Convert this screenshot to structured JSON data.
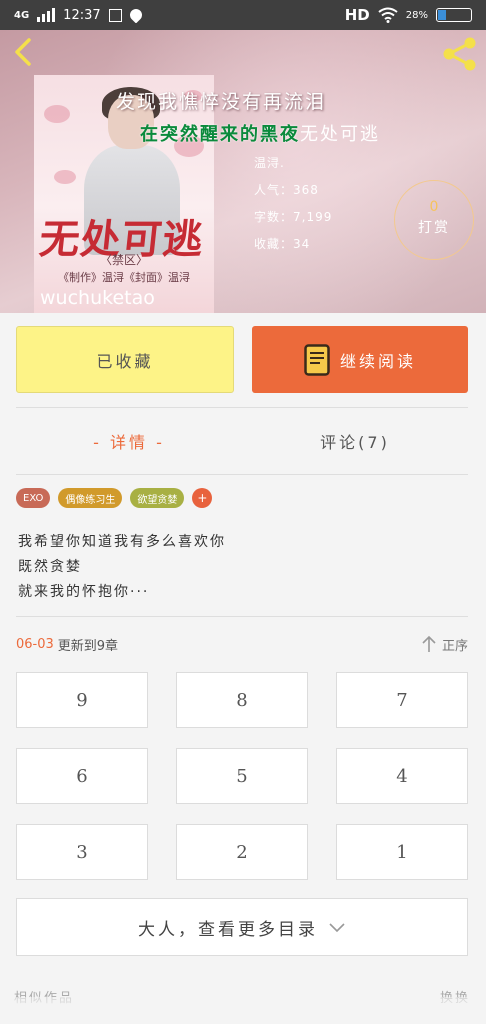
{
  "status_bar": {
    "network": "4G",
    "time": "12:37",
    "hd": "HD",
    "battery": "28%",
    "battery_level_percent": 28
  },
  "header": {
    "back_icon": "chevron-left-icon",
    "share_icon": "share-icon"
  },
  "book": {
    "quote": "发现我憔悴没有再流泪",
    "title_green": "在突然醒来的黑夜",
    "title_suffix": "无处可逃",
    "author_line": "温浔.",
    "popularity": "人气：368",
    "word_count": "字数：7,199",
    "favorites": "收藏：34",
    "reward_count": "0",
    "reward_label": "打赏"
  },
  "cover": {
    "title": "无处可逃",
    "subtitle": "〈禁区〉",
    "credit": "《制作》温浔《封面》温浔",
    "watermark": "wuchuketao"
  },
  "actions": {
    "favorite_label": "已收藏",
    "read_label": "继续阅读",
    "read_icon": "book-icon"
  },
  "tabs": [
    {
      "label": "- 详情 -",
      "active": true
    },
    {
      "label": "评论(7)",
      "active": false
    }
  ],
  "tags": [
    {
      "label": "EXO",
      "color": "#c86a57"
    },
    {
      "label": "偶像练习生",
      "color": "#d19a2b"
    },
    {
      "label": "欲望贪婪",
      "color": "#a8b043"
    },
    {
      "label": "+",
      "color": "#e8623d"
    }
  ],
  "description": {
    "line1": "我希望你知道我有多么喜欢你",
    "line2": "既然贪婪",
    "line3": "就来我的怀抱你···"
  },
  "update": {
    "date": "06-03",
    "label": "更新到9章",
    "sort_label": "正序",
    "sort_icon": "arrow-up-icon"
  },
  "chapters": [
    "9",
    "8",
    "7",
    "6",
    "5",
    "4",
    "3",
    "2",
    "1"
  ],
  "more_button": {
    "label": "大人，查看更多目录",
    "icon": "chevron-down-icon"
  },
  "footer": {
    "left_label": "相似作品",
    "right_label": "换换"
  },
  "colors": {
    "accent": "#ec6a3b",
    "favorite_bg": "#fdf387",
    "status_bar_bg": "#3f3f3f"
  }
}
